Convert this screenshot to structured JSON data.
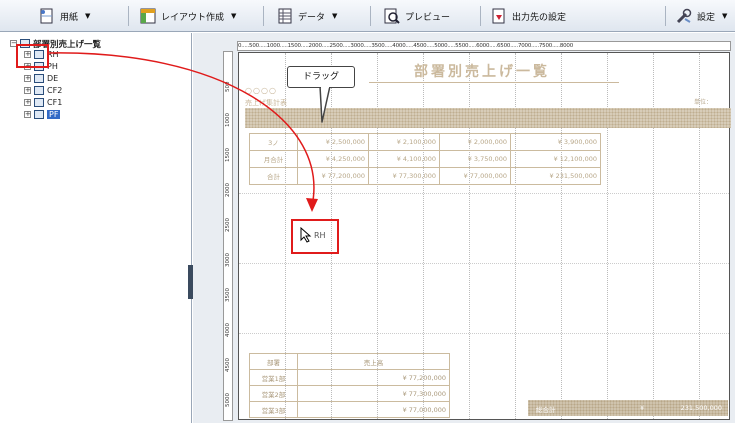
{
  "toolbar": {
    "paper_label": "用紙",
    "layout_label": "レイアウト作成",
    "data_label": "データ",
    "preview_label": "プレビュー",
    "output_label": "出力先の設定",
    "settings_label": "設定",
    "dropdown_glyph": "▼"
  },
  "tree": {
    "root_label": "部署別売上げ一覧",
    "items": [
      "RH",
      "PH",
      "DE",
      "CF2",
      "CF1",
      "PF"
    ],
    "selected": "PF"
  },
  "annotation": {
    "callout_text": "ドラッグ",
    "drop_label": "RH",
    "arrow_color": "#e01b1b"
  },
  "ruler": {
    "h_text": "0.....500.....1000.....1500.....2000.....2500.....3000.....3500.....4000.....4500.....5000.....5500.....6000.....6500.....7000.....7500.....8000",
    "v_marks": [
      "500",
      "1000",
      "1500",
      "2000",
      "2500",
      "3000",
      "3500",
      "4000",
      "4500",
      "5000"
    ]
  },
  "report": {
    "title": "部署別売上げ一覧",
    "dept_placeholder": "○○○○",
    "subtitle": "売上げ集計表",
    "unit_label": "単位：",
    "accent": "#cbb99d",
    "top_table": [
      [
        "3ノ",
        "¥ 2,500,000",
        "¥ 2,100,000",
        "¥ 2,000,000",
        "¥   3,900,000"
      ],
      [
        "月合計",
        "¥   4,250,000",
        "¥   4,100,000",
        "¥   3,750,000",
        "¥   12,100,000"
      ],
      [
        "合計",
        "¥  77,200,000",
        "¥  77,300,000",
        "¥  77,000,000",
        "¥  231,500,000"
      ]
    ],
    "bottom_table": {
      "header": [
        "部署",
        "売上高"
      ],
      "rows": [
        [
          "営業1部",
          "¥        77,200,000"
        ],
        [
          "営業2部",
          "¥        77,300,000"
        ],
        [
          "営業3部",
          "¥        77,000,000"
        ]
      ]
    },
    "grand_total_label": "総合計",
    "grand_total_currency": "¥",
    "grand_total_value": "231,500,000"
  }
}
